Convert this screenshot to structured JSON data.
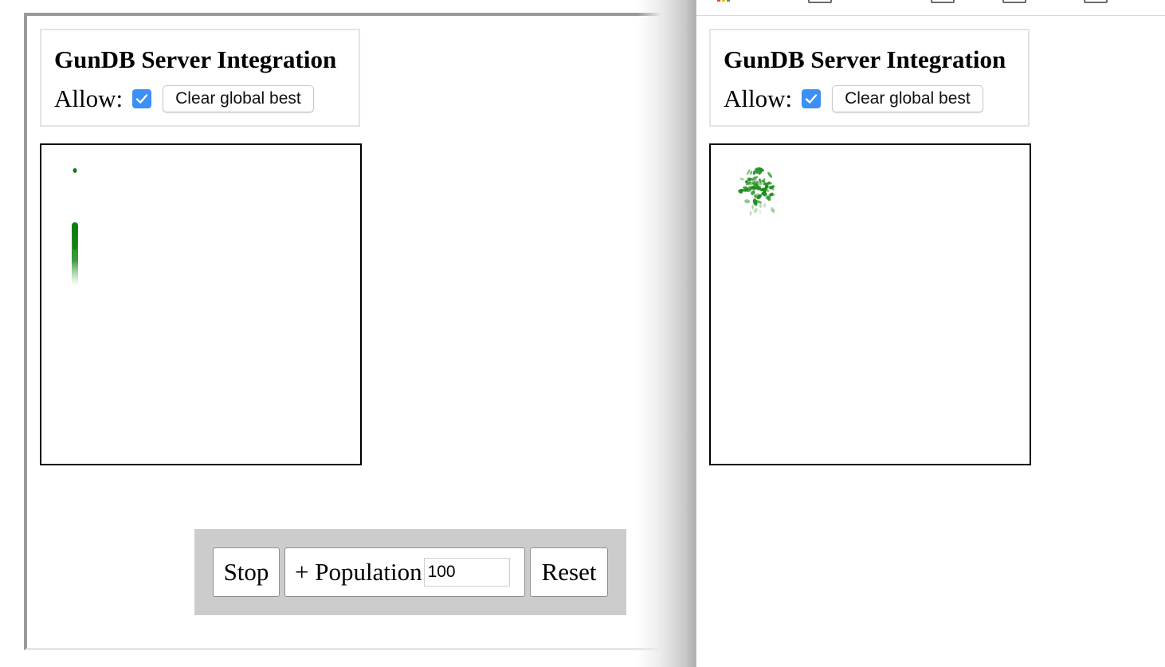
{
  "panel": {
    "title": "GunDB Server Integration",
    "allow_label": "Allow:",
    "allow_checked": true,
    "clear_button_label": "Clear global best"
  },
  "controls": {
    "stop_label": "Stop",
    "population_label": "+ Population",
    "population_value": "100",
    "reset_label": "Reset"
  },
  "colors": {
    "checkbox": "#3b8ff5",
    "organisms": "#1a8a1a",
    "controls_bar": "#cccccc"
  }
}
